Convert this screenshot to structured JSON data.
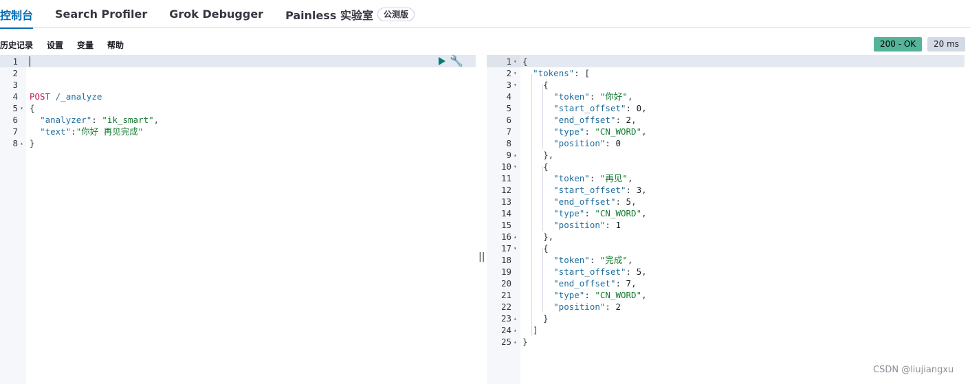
{
  "tabs": [
    {
      "label": "控制台",
      "active": true
    },
    {
      "label": "Search Profiler"
    },
    {
      "label": "Grok Debugger"
    },
    {
      "label": "Painless 实验室",
      "badge": "公测版"
    }
  ],
  "toolbar": {
    "history": "历史记录",
    "settings": "设置",
    "variables": "变量",
    "help": "帮助",
    "status": "200 - OK",
    "time": "20 ms"
  },
  "request": {
    "lines": [
      {
        "n": "1",
        "text": ""
      },
      {
        "n": "2",
        "text": ""
      },
      {
        "n": "3",
        "text": ""
      },
      {
        "n": "4",
        "text": "POST /_analyze"
      },
      {
        "n": "5",
        "text": "{"
      },
      {
        "n": "6",
        "text": "  \"analyzer\": \"ik_smart\","
      },
      {
        "n": "7",
        "text": "  \"text\":\"你好 再见完成\""
      },
      {
        "n": "8",
        "text": "}"
      }
    ]
  },
  "response": {
    "lines": [
      {
        "n": "1",
        "text": "{"
      },
      {
        "n": "2",
        "text": "  \"tokens\": ["
      },
      {
        "n": "3",
        "text": "    {"
      },
      {
        "n": "4",
        "text": "      \"token\": \"你好\","
      },
      {
        "n": "5",
        "text": "      \"start_offset\": 0,"
      },
      {
        "n": "6",
        "text": "      \"end_offset\": 2,"
      },
      {
        "n": "7",
        "text": "      \"type\": \"CN_WORD\","
      },
      {
        "n": "8",
        "text": "      \"position\": 0"
      },
      {
        "n": "9",
        "text": "    },"
      },
      {
        "n": "10",
        "text": "    {"
      },
      {
        "n": "11",
        "text": "      \"token\": \"再见\","
      },
      {
        "n": "12",
        "text": "      \"start_offset\": 3,"
      },
      {
        "n": "13",
        "text": "      \"end_offset\": 5,"
      },
      {
        "n": "14",
        "text": "      \"type\": \"CN_WORD\","
      },
      {
        "n": "15",
        "text": "      \"position\": 1"
      },
      {
        "n": "16",
        "text": "    },"
      },
      {
        "n": "17",
        "text": "    {"
      },
      {
        "n": "18",
        "text": "      \"token\": \"完成\","
      },
      {
        "n": "19",
        "text": "      \"start_offset\": 5,"
      },
      {
        "n": "20",
        "text": "      \"end_offset\": 7,"
      },
      {
        "n": "21",
        "text": "      \"type\": \"CN_WORD\","
      },
      {
        "n": "22",
        "text": "      \"position\": 2"
      },
      {
        "n": "23",
        "text": "    }"
      },
      {
        "n": "24",
        "text": "  ]"
      },
      {
        "n": "25",
        "text": "}"
      }
    ]
  },
  "divider": "||",
  "watermark": "CSDN @liujiangxu"
}
